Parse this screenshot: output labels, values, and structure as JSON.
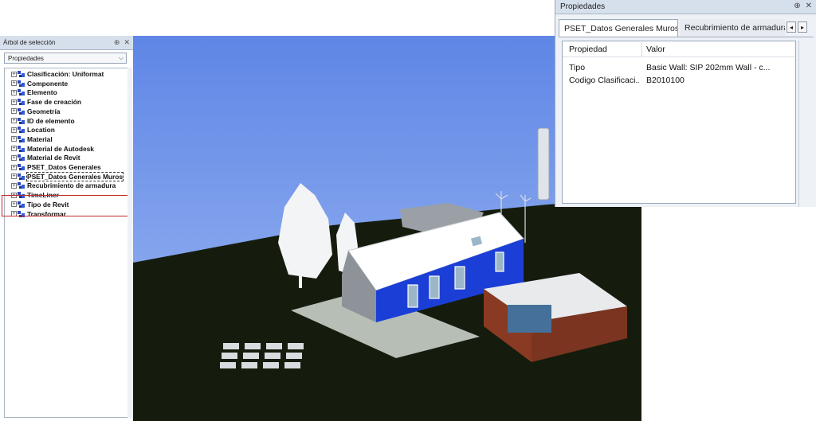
{
  "tree_panel": {
    "title": "Árbol de selección",
    "dropdown_value": "Propiedades",
    "items": [
      {
        "label": "Clasificación: Uniformat"
      },
      {
        "label": "Componente"
      },
      {
        "label": "Elemento"
      },
      {
        "label": "Fase de creación"
      },
      {
        "label": "Geometría"
      },
      {
        "label": "ID de elemento"
      },
      {
        "label": "Location"
      },
      {
        "label": "Material"
      },
      {
        "label": "Material de Autodesk"
      },
      {
        "label": "Material de Revit"
      },
      {
        "label": "PSET_Datos Generales"
      },
      {
        "label": "PSET_Datos Generales Muros"
      },
      {
        "label": "Recubrimiento de armadura"
      },
      {
        "label": "TimeLiner"
      },
      {
        "label": "Tipo de Revit"
      },
      {
        "label": "Transformar"
      }
    ],
    "highlight_color": "#c0292b"
  },
  "properties_panel": {
    "title": "Propiedades",
    "tabs": [
      {
        "label": "PSET_Datos Generales Muros"
      },
      {
        "label": "Recubrimiento de armadura"
      }
    ],
    "columns": [
      "Propiedad",
      "Valor"
    ],
    "rows": [
      {
        "property": "Tipo",
        "value": "Basic Wall: SIP 202mm Wall - c..."
      },
      {
        "property": "Codigo Clasificaci...",
        "value": "B2010100"
      }
    ]
  },
  "icons": {
    "expand": "plus-box-icon",
    "category": "property-category-icon",
    "pin": "pin-icon",
    "close": "close-icon",
    "tab_left": "chevron-left-icon",
    "tab_right": "chevron-right-icon",
    "dropdown": "chevron-down-icon"
  },
  "colors": {
    "accent_wall_blue": "#1b3fd6",
    "sky_top": "#5f86e6",
    "ground": "#151c0d",
    "cladding_brown": "#8a3a22"
  }
}
